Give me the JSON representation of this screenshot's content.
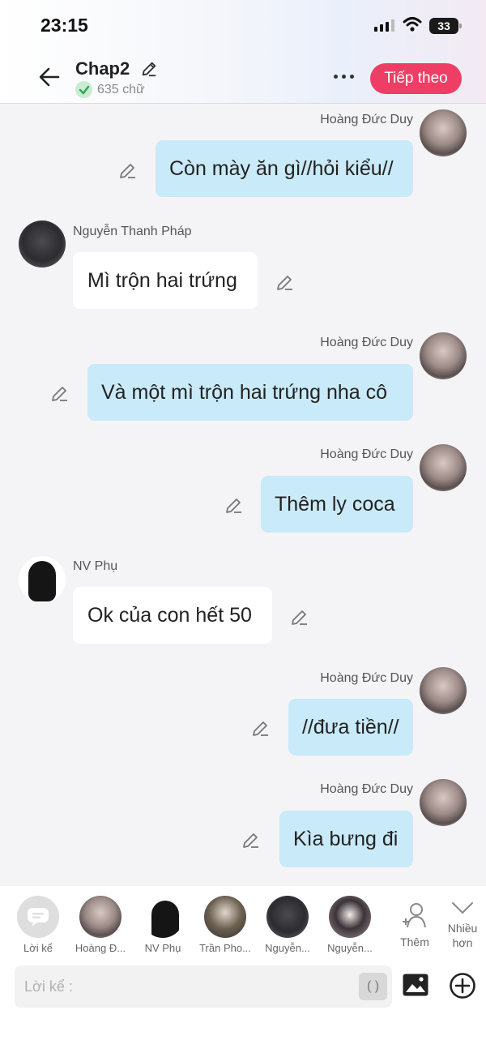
{
  "status": {
    "time": "23:15",
    "battery": "33"
  },
  "header": {
    "title": "Chap2",
    "word_count": "635 chữ",
    "next_label": "Tiếp theo"
  },
  "messages": [
    {
      "sender": "Hoàng Đức Duy",
      "text": "Còn mày ăn gì//hỏi kiểu//",
      "side": "right"
    },
    {
      "sender": "Nguyễn Thanh Pháp",
      "text": "Mì trộn hai trứng",
      "side": "left"
    },
    {
      "sender": "Hoàng Đức Duy",
      "text": "Và một mì trộn hai trứng nha cô",
      "side": "right"
    },
    {
      "sender": "Hoàng Đức Duy",
      "text": "Thêm ly coca",
      "side": "right"
    },
    {
      "sender": "NV Phụ",
      "text": "Ok của con hết 50",
      "side": "left"
    },
    {
      "sender": "Hoàng Đức Duy",
      "text": "//đưa tiền//",
      "side": "right"
    },
    {
      "sender": "Hoàng Đức Duy",
      "text": "Kìa bưng đi",
      "side": "right"
    }
  ],
  "characters": [
    {
      "label": "Lời kể"
    },
    {
      "label": "Hoàng Đ..."
    },
    {
      "label": "NV Phụ"
    },
    {
      "label": "Trần Pho..."
    },
    {
      "label": "Nguyễn..."
    },
    {
      "label": "Nguyễn..."
    }
  ],
  "actions": {
    "add_label": "Thêm",
    "more_label": "Nhiều hơn"
  },
  "composer": {
    "placeholder": "Lời kể :",
    "paren": "( )"
  },
  "icons": [
    "back-arrow-icon",
    "pencil-icon",
    "check-icon",
    "more-dots-icon",
    "person-add-icon",
    "chevron-down-icon",
    "image-icon",
    "plus-circle-icon",
    "chat-icon"
  ],
  "colors": {
    "accent": "#ef3e66",
    "out_bubble": "#c9eaf8",
    "in_bubble": "#ffffff",
    "background": "#f4f4f6"
  }
}
